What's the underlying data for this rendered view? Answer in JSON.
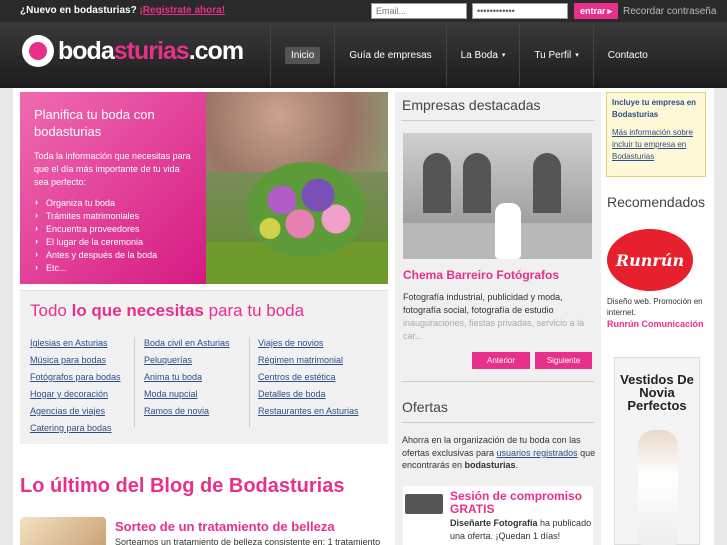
{
  "topbar": {
    "question": "¿Nuevo en bodasturias?",
    "register": "¡Registrate ahora!",
    "email_placeholder": "Email...",
    "password_value": "••••••••••••",
    "login_label": "entrar",
    "login_icon": "arrow-right-icon",
    "remember": "Recordar contraseña"
  },
  "logo": {
    "brand_pre": "boda",
    "brand_mid": "sturias",
    "brand_post": ".com"
  },
  "nav": {
    "items": [
      {
        "label": "Inicio"
      },
      {
        "label": "Guía de empresas"
      },
      {
        "label": "La Boda",
        "caret": "▾"
      },
      {
        "label": "Tu Perfil",
        "caret": "▾"
      },
      {
        "label": "Contacto"
      }
    ]
  },
  "hero": {
    "title": "Planifica tu boda con bodasturias",
    "text": "Toda la información que necesitas para que el día más importante de tu vida sea perfecto:",
    "items": [
      "Organiza tu boda",
      "Trámites matrimoniales",
      "Encuentra proveedores",
      "El lugar de la ceremonia",
      "Antes y después de la boda",
      "Etc..."
    ]
  },
  "todo": {
    "title_a": "Todo ",
    "title_b": "lo que necesitas",
    "title_c": " para tu boda",
    "col1": [
      "Iglesias en Asturias",
      "Música para bodas",
      "Fotógrafos para bodas",
      "Hogar y decoración",
      "Agencias de viajes",
      "Catering para bodas"
    ],
    "col2": [
      "Boda civil en Asturias",
      "Peluquerías",
      "Anima tu boda",
      "Moda nupcial",
      "Ramos de novia"
    ],
    "col3": [
      "Viajes de novios",
      "Régimen matrimonial",
      "Centros de estética",
      "Detalles de boda",
      "Restaurantes en Asturias"
    ]
  },
  "blog": {
    "title": "Lo último del Blog de Bodasturias",
    "post_title": "Sorteo de un tratamiento de belleza",
    "post_text": "Sorteamos un tratamiento de belleza consistente en: 1 tratamiento"
  },
  "featured": {
    "heading": "Empresas destacadas",
    "name": "Chema Barreiro Fotógrafos",
    "desc": "Fotografía industrial, publicidad y moda, fotografía social, fotografía de estudio",
    "desc_fade": "inauguraciones, fiestas privadas, servicio a la car...",
    "prev": "Anterior",
    "next": "Siguiente"
  },
  "ofertas": {
    "heading": "Ofertas",
    "text_a": "Ahorra en la organización de tu boda con las ofertas exclusivas para ",
    "link": "usuarios registrados",
    "text_b": " que encontrarás en ",
    "brand": "bodasturias",
    "text_c": ".",
    "card_title": "Sesión de compromiso GRATIS",
    "card_company": "Diseñarte Fotografía",
    "card_text": " ha publicado una oferta. ¡Quedan 1 días!"
  },
  "sidebar": {
    "promo_title": "Incluye tu empresa en Bodasturias",
    "promo_link": "Más información sobre incluir tu empresa en Bodasturias",
    "reco_heading": "Recomendados",
    "reco_logo": "Runrún",
    "reco_desc": "Diseño web. Promoción en internet.",
    "reco_name": "Runrún Comunicación",
    "ad_text": "Vestidos De Novia Perfectos"
  },
  "colors": {
    "accent": "#e8308a",
    "topbar": "#2a2a2a",
    "link": "#2b4f8c"
  }
}
